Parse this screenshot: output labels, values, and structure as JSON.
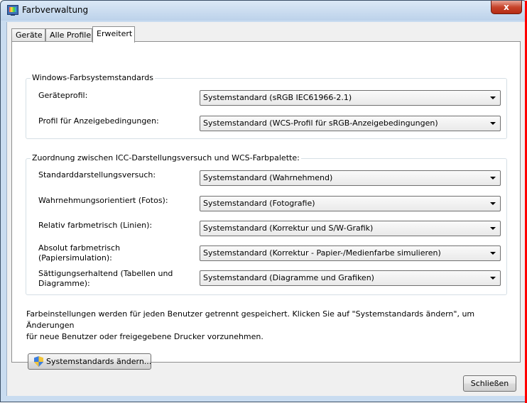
{
  "window": {
    "title": "Farbverwaltung",
    "close_label": "x"
  },
  "tabs": [
    {
      "label": "Geräte",
      "active": false
    },
    {
      "label": "Alle Profile",
      "active": false
    },
    {
      "label": "Erweitert",
      "active": true
    }
  ],
  "group1": {
    "legend": "Windows-Farbsystemstandards",
    "rows": [
      {
        "label": "Geräteprofil:",
        "value": "Systemstandard (sRGB IEC61966-2.1)"
      },
      {
        "label": "Profil für Anzeigebedingungen:",
        "value": "Systemstandard (WCS-Profil für sRGB-Anzeigebedingungen)"
      }
    ]
  },
  "group2": {
    "legend": "Zuordnung zwischen ICC-Darstellungsversuch und WCS-Farbpalette:",
    "rows": [
      {
        "label_line1": "Standarddarstellungsversuch:",
        "label_line2": "",
        "value": "Systemstandard (Wahrnehmend)"
      },
      {
        "label_line1": "Wahrnehmungsorientiert (Fotos):",
        "label_line2": "",
        "value": "Systemstandard (Fotografie)"
      },
      {
        "label_line1": "Relativ farbmetrisch (Linien):",
        "label_line2": "",
        "value": "Systemstandard (Korrektur und S/W-Grafik)"
      },
      {
        "label_line1": "Absolut farbmetrisch",
        "label_line2": "(Papiersimulation):",
        "value": "Systemstandard (Korrektur - Papier-/Medienfarbe simulieren)"
      },
      {
        "label_line1": "Sättigungserhaltend (Tabellen und",
        "label_line2": "Diagramme):",
        "value": "Systemstandard (Diagramme und Grafiken)"
      }
    ]
  },
  "info_text_line1": "Farbeinstellungen werden für jeden Benutzer getrennt gespeichert. Klicken Sie auf \"Systemstandards ändern\", um Änderungen",
  "info_text_line2": "für neue Benutzer oder freigegebene Drucker vorzunehmen.",
  "change_defaults_button": "Systemstandards ändern...",
  "close_button": "Schließen"
}
